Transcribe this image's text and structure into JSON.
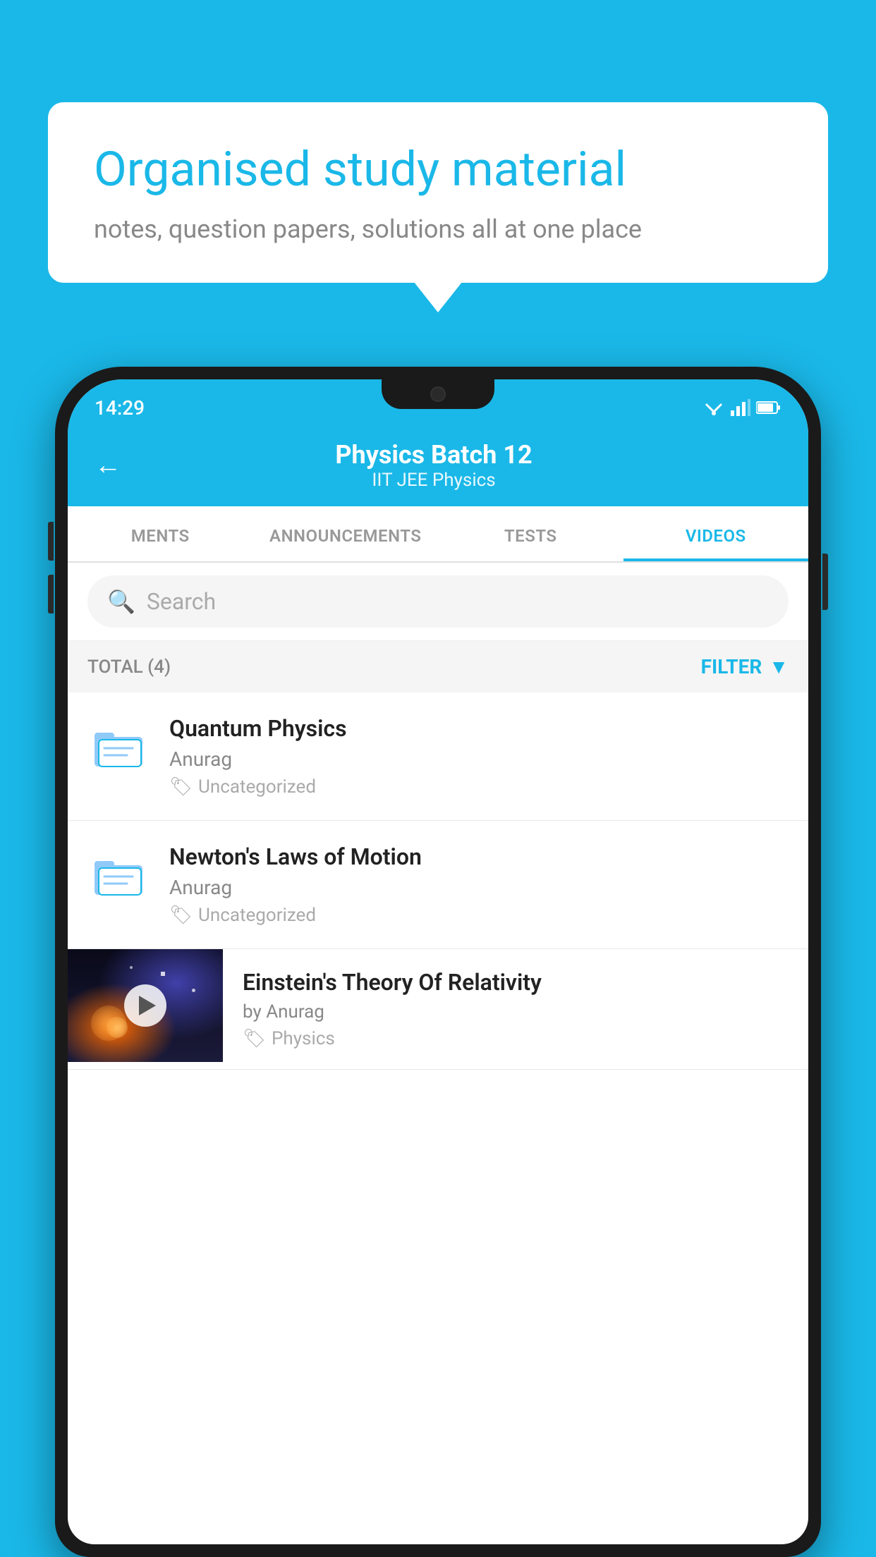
{
  "background": {
    "color": "#1ab8e8"
  },
  "speech_bubble": {
    "title": "Organised study material",
    "subtitle": "notes, question papers, solutions all at one place"
  },
  "phone": {
    "status_bar": {
      "time": "14:29"
    },
    "header": {
      "back_label": "←",
      "title": "Physics Batch 12",
      "subtitle": "IIT JEE   Physics"
    },
    "tabs": [
      {
        "label": "MENTS",
        "active": false
      },
      {
        "label": "ANNOUNCEMENTS",
        "active": false
      },
      {
        "label": "TESTS",
        "active": false
      },
      {
        "label": "VIDEOS",
        "active": true
      }
    ],
    "search": {
      "placeholder": "Search"
    },
    "filter_bar": {
      "total_label": "TOTAL (4)",
      "filter_label": "FILTER"
    },
    "videos": [
      {
        "id": "quantum",
        "title": "Quantum Physics",
        "author": "Anurag",
        "tag": "Uncategorized",
        "type": "folder"
      },
      {
        "id": "newton",
        "title": "Newton's Laws of Motion",
        "author": "Anurag",
        "tag": "Uncategorized",
        "type": "folder"
      },
      {
        "id": "einstein",
        "title": "Einstein's Theory Of Relativity",
        "author": "by Anurag",
        "tag": "Physics",
        "type": "video"
      }
    ]
  }
}
